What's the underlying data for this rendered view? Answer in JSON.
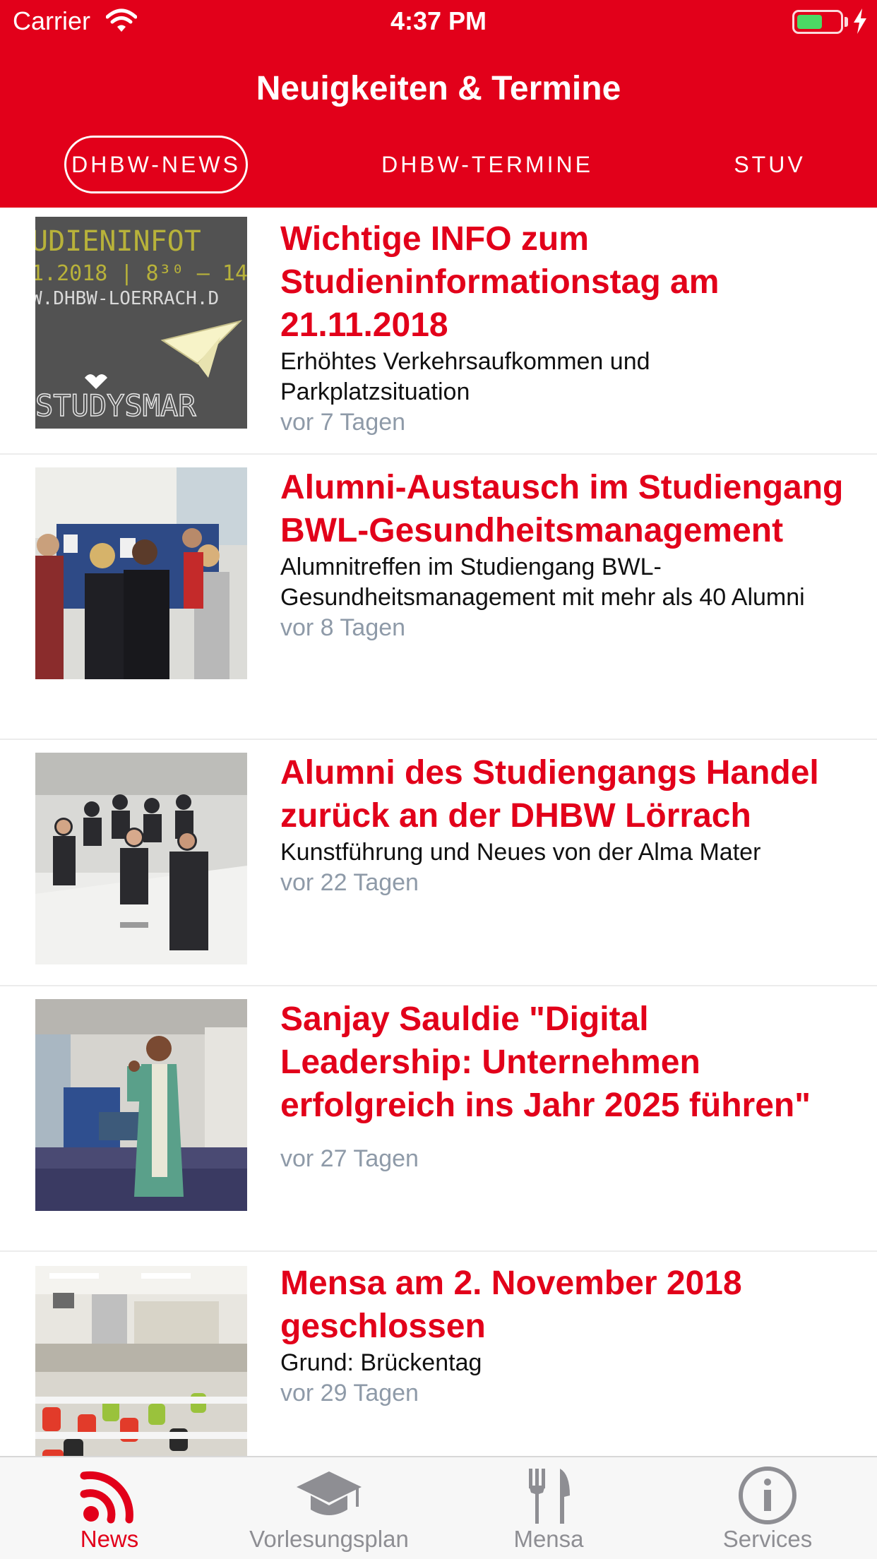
{
  "status_bar": {
    "carrier": "Carrier",
    "time": "4:37 PM",
    "battery_level": 0.6
  },
  "nav": {
    "title": "Neuigkeiten & Termine"
  },
  "tabs": [
    {
      "label": "DHBW-NEWS",
      "active": true
    },
    {
      "label": "DHBW-TERMINE",
      "active": false
    },
    {
      "label": "STUV",
      "active": false
    }
  ],
  "news": [
    {
      "title": "Wichtige INFO zum Studieninformationstag am 21.11.2018",
      "subtitle": "Erhöhtes Verkehrsaufkommen und Parkplatzsituation",
      "time": "vor 7 Tagen",
      "image": "chalkboard-studysmart-image",
      "image_text_lines": [
        "UDIENINFOT",
        "1.2018 | 8³⁰ – 14",
        "W.DHBW-LOERRACH.D",
        "STUDYSMAR"
      ]
    },
    {
      "title": "Alumni-Austausch im Studiengang BWL-Gesundheitsmanagement",
      "subtitle": "Alumnitreffen im Studiengang BWL-Gesundheitsmanagement mit mehr als 40 Alumni",
      "time": "vor 8 Tagen",
      "image": "group-of-people-image"
    },
    {
      "title": "Alumni des Studiengangs Handel  zurück an der DHBW Lörrach",
      "subtitle": "Kunstführung und Neues von der Alma Mater",
      "time": "vor 22 Tagen",
      "image": "lecture-hall-group-image"
    },
    {
      "title": "Sanjay Sauldie \"Digital Leadership: Unternehmen erfolgreich ins Jahr 2025 führen\"",
      "subtitle": "",
      "time": "vor 27 Tagen",
      "image": "speaker-on-stage-image"
    },
    {
      "title": "Mensa am 2. November 2018 geschlossen",
      "subtitle": "Grund: Brückentag",
      "time": "vor 29 Tagen",
      "image": "cafeteria-image"
    }
  ],
  "tabbar": [
    {
      "label": "News",
      "icon": "rss-icon",
      "active": true
    },
    {
      "label": "Vorlesungsplan",
      "icon": "graduation-cap-icon",
      "active": false
    },
    {
      "label": "Mensa",
      "icon": "fork-knife-icon",
      "active": false
    },
    {
      "label": "Services",
      "icon": "info-icon",
      "active": false
    }
  ],
  "colors": {
    "brand": "#e2001a",
    "time_text": "#8e9aa8",
    "inactive_tab": "#8e8e93"
  }
}
